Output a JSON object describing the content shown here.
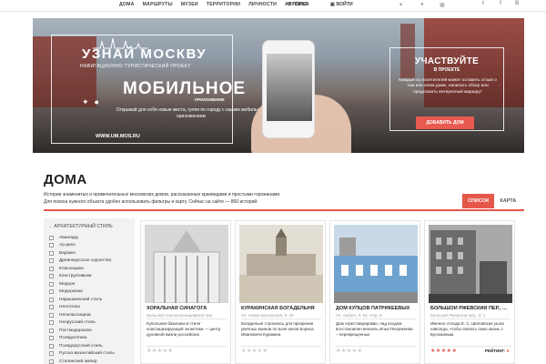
{
  "topnav": {
    "menu": [
      "ДОМА",
      "МАРШРУТЫ",
      "МУЗЕИ",
      "ТЕРРИТОРИИ",
      "ЛИЧНОСТИ",
      "АВТОРЫ"
    ],
    "search": "ПОИСК",
    "login": "ВОЙТИ",
    "os_icons": [
      "android-icon",
      "apple-icon",
      "windows-icon"
    ],
    "social": [
      "t",
      "f",
      "В"
    ]
  },
  "hero": {
    "logo": "УЗНАЙ МОСКВУ",
    "logo_sub": "НАВИГАЦИОННО-ТУРИСТИЧЕСКИЙ ПРОЕКТ",
    "mobile_title": "МОБИЛЬНОЕ",
    "mobile_sub": "ПРИЛОЖЕНИЕ",
    "mobile_desc": "Открывай для себя новые места, гуляя по городу с нашим мобильным приложением",
    "site": "WWW.UM.MOS.RU",
    "join_title": "УЧАСТВУЙТЕ",
    "join_sub": "В ПРОЕКТЕ",
    "join_desc": "Каждый из посетителей может оставить отзыв о том или ином доме, написать обзор или предложить интересный маршрут",
    "add_button": "ДОБАВИТЬ ДОМ"
  },
  "section": {
    "title": "ДОМА",
    "desc_line1": "Истории знаменитых и примечательных московских домов, рассказанные краеведами и простыми горожанами.",
    "desc_line2": "Для поиска нужного объекта удобно использовать фильтры и карту. Сейчас на сайте — 860 историй.",
    "tab_list": "СПИСОК",
    "tab_map": "КАРТА"
  },
  "filter": {
    "heading": "АРХИТЕКТУРНЫЙ СТИЛЬ",
    "items": [
      "Авангард",
      "Ар-деко",
      "Барокко",
      "Древнерусское зодчество",
      "Классицизм",
      "Конструктивизм",
      "Модерн",
      "Модернизм",
      "Нарышкинский стиль",
      "Неоготика",
      "Неоклассицизм",
      "Неорусский стиль",
      "Постмодернизм",
      "Псевдоготика",
      "Псевдорусский стиль",
      "Русско-византийский стиль",
      "Сталинский ампир"
    ]
  },
  "cards": [
    {
      "title": "ХОРАЛЬНАЯ СИНАГОГА",
      "address": "Большой Спасоглинищевский пер.",
      "text": "Купольная базилика в стиле классицизирующей эклектики — центр духовной жизни российских",
      "stars": "★★★★★",
      "rating_label": "",
      "rating": ""
    },
    {
      "title": "КУРАКИНСКАЯ БОГАДЕЛЬНЯ",
      "address": "Ул. Новая Басманная, д. 26",
      "text": "Богадельня строилась для призрения увечных воинов по воле князя Бориса Ивановича Куракина",
      "stars": "★★★★★",
      "rating_label": "",
      "rating": ""
    },
    {
      "title": "ДОМ КУПЦОВ ПАТРИКЕЕВЫХ",
      "address": "Ул. Арбат, д. 53, стр. 8",
      "text": "Дом отреставрирован, над входом восстановлен вензель Ильи Патрикеева – перекрещенные",
      "stars": "★★★★★",
      "rating_label": "",
      "rating": ""
    },
    {
      "title": "БОЛЬШОЙ РЖЕВСКИЙ ПЕР., …",
      "address": "Большой Ржевский пер., д. 1",
      "text": "Именно отсюда Е. С. Шиловская ушла навсегда, чтобы связать свою жизнь с Булгаковым.",
      "stars": "★★★★★",
      "rating_label": "РЕЙТИНГ",
      "rating": "5"
    }
  ],
  "colors": {
    "accent": "#e5574b"
  }
}
